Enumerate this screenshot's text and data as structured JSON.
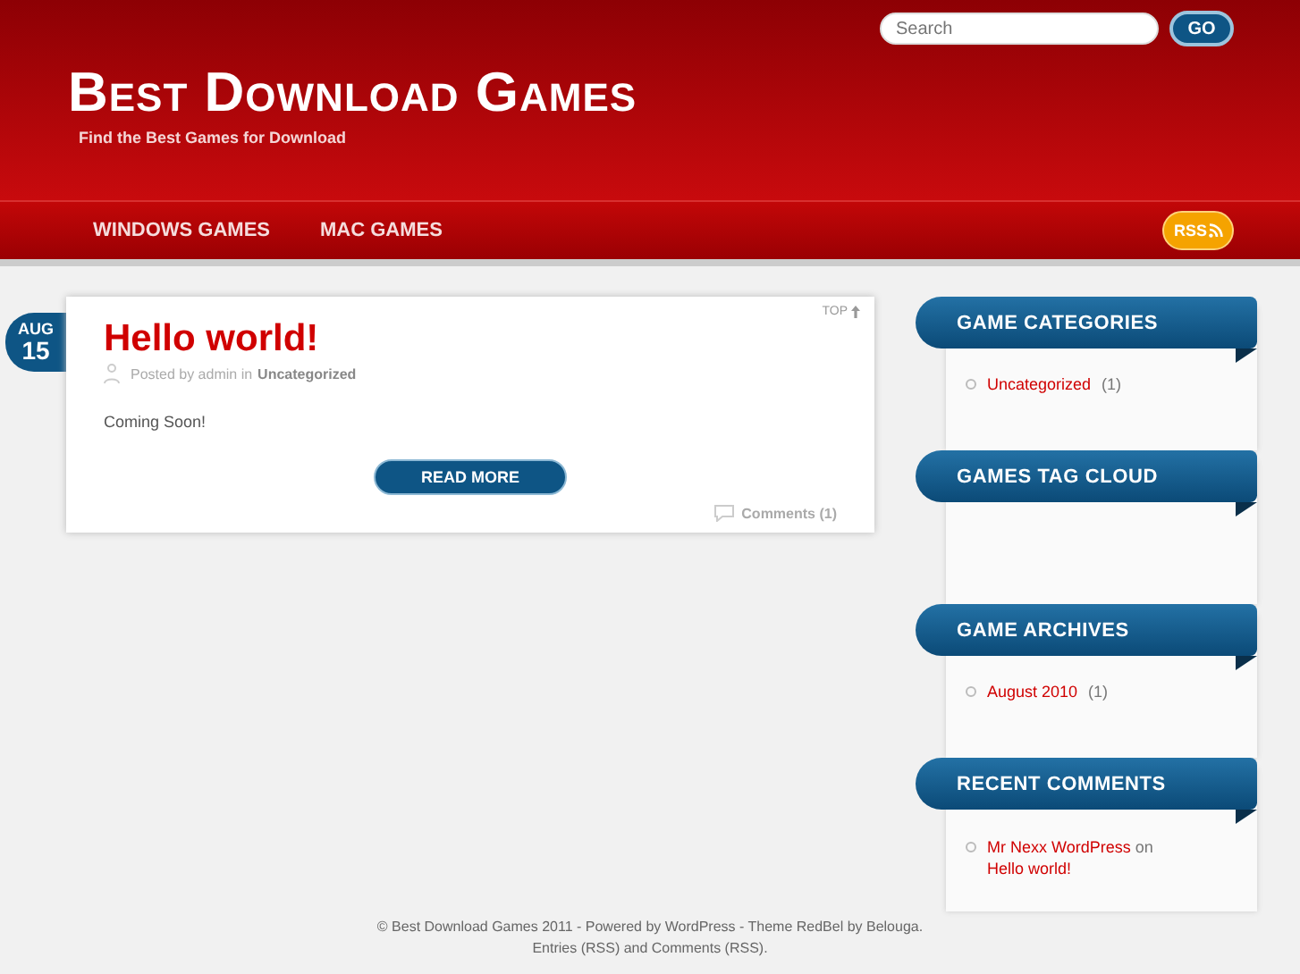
{
  "search": {
    "placeholder": "Search",
    "button": "GO"
  },
  "site": {
    "title": "Best Download Games",
    "tagline": "Find the Best Games for Download"
  },
  "nav": {
    "items": [
      {
        "label": "WINDOWS GAMES"
      },
      {
        "label": "MAC GAMES"
      }
    ],
    "rss": "RSS"
  },
  "post": {
    "month": "AUG",
    "day": "15",
    "top": "TOP",
    "title": "Hello world!",
    "posted_by": "Posted by admin in",
    "category": "Uncategorized",
    "body": "Coming Soon!",
    "read_more": "READ MORE",
    "comments": "Comments (1)"
  },
  "widgets": [
    {
      "title": "GAME CATEGORIES",
      "kind": "list",
      "items": [
        {
          "link": "Uncategorized",
          "count": "(1)"
        }
      ]
    },
    {
      "title": "GAMES TAG CLOUD",
      "kind": "cloud"
    },
    {
      "title": "GAME ARCHIVES",
      "kind": "list",
      "items": [
        {
          "link": "August 2010",
          "count": "(1)"
        }
      ]
    },
    {
      "title": "RECENT COMMENTS",
      "kind": "comments",
      "items": [
        {
          "author": "Mr Nexx WordPress",
          "on": "on",
          "post": "Hello world!"
        }
      ]
    }
  ],
  "footer": {
    "line_1": "© Best Download Games 2011 - Powered by WordPress - Theme RedBel by Belouga.",
    "line_2": "Entries (RSS) and Comments (RSS)."
  }
}
